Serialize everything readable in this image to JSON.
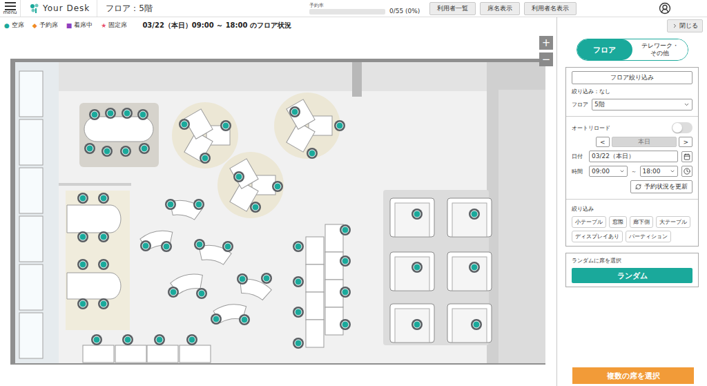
{
  "header": {
    "menu_label": "menu",
    "logo": "Your Desk",
    "floor_title": "フロア：5階",
    "rate": {
      "label": "予約率",
      "level": 0,
      "reading": "0/55 (0%)"
    },
    "buttons": [
      {
        "label": "利用者一覧"
      },
      {
        "label": "席名表示"
      },
      {
        "label": "利用者名表示"
      }
    ]
  },
  "legend": [
    {
      "symbol": "●",
      "label": "空席",
      "color": "#1aa99b"
    },
    {
      "symbol": "◆",
      "label": "予約席",
      "color": "#f08a24"
    },
    {
      "symbol": "■",
      "label": "着席中",
      "color": "#8e3fbf"
    },
    {
      "symbol": "★",
      "label": "固定席",
      "color": "#e8506e"
    }
  ],
  "status_text": "03/22（本日）09:00 ～ 18:00 のフロア状況",
  "zoom": [
    "+",
    "−"
  ],
  "floor": {
    "seats": [
      {
        "color": "#1aa99b"
      },
      {
        "color": "#1aa99b"
      },
      {
        "color": "#1aa99b"
      },
      {
        "color": "#1aa99b"
      },
      {
        "color": "#1aa99b"
      },
      {
        "color": "#1aa99b"
      },
      {
        "color": "#1aa99b"
      },
      {
        "color": "#1aa99b"
      },
      {
        "color": "#1aa99b"
      },
      {
        "color": "#1aa99b"
      },
      {
        "color": "#1aa99b"
      },
      {
        "color": "#1aa99b"
      },
      {
        "color": "#1aa99b"
      },
      {
        "color": "#1aa99b"
      },
      {
        "color": "#1aa99b"
      },
      {
        "color": "#1aa99b"
      },
      {
        "color": "#1aa99b"
      },
      {
        "color": "#1aa99b"
      },
      {
        "color": "#1aa99b"
      },
      {
        "color": "#1aa99b"
      },
      {
        "color": "#1aa99b"
      },
      {
        "color": "#1aa99b"
      },
      {
        "color": "#1aa99b"
      },
      {
        "color": "#1aa99b"
      },
      {
        "color": "#1aa99b"
      },
      {
        "color": "#1aa99b"
      },
      {
        "color": "#1aa99b"
      },
      {
        "color": "#1aa99b"
      },
      {
        "color": "#1aa99b"
      },
      {
        "color": "#1aa99b"
      },
      {
        "color": "#1aa99b"
      },
      {
        "color": "#1aa99b"
      },
      {
        "color": "#1aa99b"
      },
      {
        "color": "#1aa99b"
      },
      {
        "color": "#1aa99b"
      },
      {
        "color": "#1aa99b"
      },
      {
        "color": "#1aa99b"
      },
      {
        "color": "#1aa99b"
      },
      {
        "color": "#1aa99b"
      },
      {
        "color": "#1aa99b"
      },
      {
        "color": "#1aa99b"
      },
      {
        "color": "#1aa99b"
      },
      {
        "color": "#1aa99b"
      },
      {
        "color": "#1aa99b"
      },
      {
        "color": "#1aa99b"
      },
      {
        "color": "#1aa99b"
      },
      {
        "color": "#1aa99b"
      },
      {
        "color": "#1aa99b"
      },
      {
        "color": "#1aa99b"
      },
      {
        "color": "#1aa99b"
      },
      {
        "color": "#1aa99b"
      },
      {
        "color": "#1aa99b"
      },
      {
        "color": "#1aa99b"
      },
      {
        "color": "#1aa99b"
      },
      {
        "color": "#1aa99b"
      }
    ]
  },
  "panel": {
    "close": "閉じる",
    "tabs": [
      {
        "label": "フロア",
        "selected": true
      },
      {
        "label": "テレワーク・その他",
        "selected": false
      }
    ],
    "filter_button": "フロア絞り込み",
    "filter_status": "絞り込み：なし",
    "floor_field": {
      "label": "フロア",
      "value": "5階"
    },
    "auto_reload": {
      "label": "オートリロード",
      "on": false
    },
    "date_nav": {
      "prev": "<",
      "today": "本日",
      "next": ">",
      "today_disabled": true
    },
    "date_field": {
      "label": "日付",
      "value": "03/22（本日）"
    },
    "time_field": {
      "label": "時間",
      "start": "09:00",
      "separator": "～",
      "end": "18:00"
    },
    "refresh_button": "予約状況を更新",
    "tags_label": "絞り込み",
    "tags": [
      {
        "label": "小テーブル",
        "selected": false
      },
      {
        "label": "窓際",
        "selected": false
      },
      {
        "label": "廊下側",
        "selected": false
      },
      {
        "label": "大テーブル",
        "selected": false
      },
      {
        "label": "ディスプレイあり",
        "selected": false
      },
      {
        "label": "パーティション",
        "selected": false
      }
    ],
    "random": {
      "title": "ランダムに席を選択",
      "button": "ランダム"
    },
    "multi_button": "複数の席を選択"
  }
}
